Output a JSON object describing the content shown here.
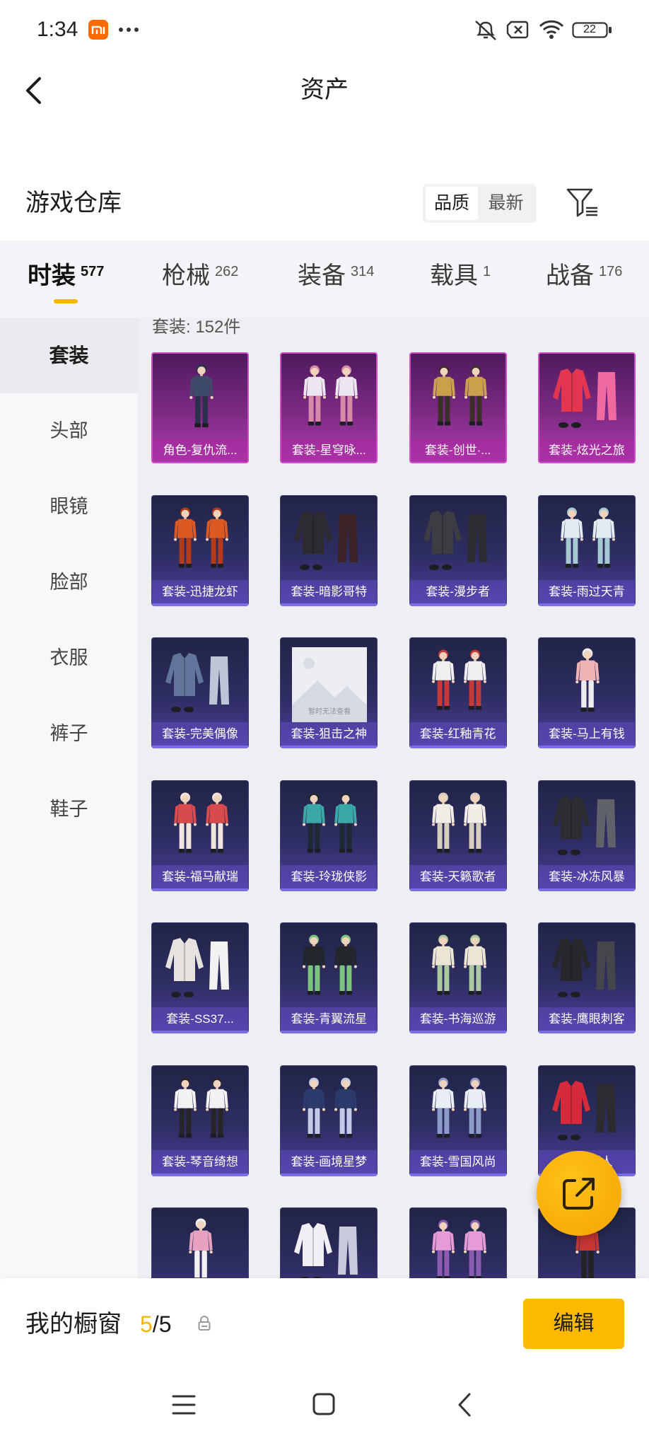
{
  "status_bar": {
    "time": "1:34",
    "battery": "22",
    "icons": [
      "xiaomi-icon",
      "more-dots-icon",
      "mute-icon",
      "no-sim-icon",
      "wifi-icon",
      "battery-icon"
    ]
  },
  "header": {
    "title": "资产",
    "back_icon": "chevron-left-icon"
  },
  "warehouse": {
    "title": "游戏仓库",
    "sort_options": [
      {
        "label": "品质",
        "active": true
      },
      {
        "label": "最新",
        "active": false
      }
    ],
    "filter_icon": "filter-icon"
  },
  "tabs": [
    {
      "label": "时装",
      "count": "577",
      "active": true
    },
    {
      "label": "枪械",
      "count": "262",
      "active": false
    },
    {
      "label": "装备",
      "count": "314",
      "active": false
    },
    {
      "label": "载具",
      "count": "1",
      "active": false
    },
    {
      "label": "战备",
      "count": "176",
      "active": false
    }
  ],
  "sidebar": {
    "items": [
      {
        "label": "套装",
        "active": true
      },
      {
        "label": "头部",
        "active": false
      },
      {
        "label": "眼镜",
        "active": false
      },
      {
        "label": "脸部",
        "active": false
      },
      {
        "label": "衣服",
        "active": false
      },
      {
        "label": "裤子",
        "active": false
      },
      {
        "label": "鞋子",
        "active": false
      }
    ]
  },
  "grid": {
    "count_label": "套装: 152件",
    "items": [
      {
        "label": "角色-复仇流...",
        "rarity": "legendary",
        "art": "figures",
        "figures": 1,
        "palette": [
          "#3d4a68",
          "#29324a"
        ]
      },
      {
        "label": "套装-星穹咏...",
        "rarity": "legendary",
        "art": "figures",
        "figures": 2,
        "palette": [
          "#ece6f0",
          "#d58aa8"
        ]
      },
      {
        "label": "套装-创世·...",
        "rarity": "legendary",
        "art": "figures",
        "figures": 2,
        "palette": [
          "#c9a14c",
          "#3b2f2a"
        ]
      },
      {
        "label": "套装-炫光之旅",
        "rarity": "legendary",
        "art": "garments",
        "palette": [
          "#e23650",
          "#f06aa0"
        ]
      },
      {
        "label": "套装-迅捷龙虾",
        "rarity": "epic",
        "art": "figures",
        "figures": 2,
        "palette": [
          "#dc5a22",
          "#b33b1a"
        ]
      },
      {
        "label": "套装-暗影哥特",
        "rarity": "epic",
        "art": "garments",
        "palette": [
          "#2d2b30",
          "#3a2226"
        ]
      },
      {
        "label": "套装-漫步者",
        "rarity": "epic",
        "art": "garments",
        "palette": [
          "#3c3d43",
          "#2c2d33"
        ]
      },
      {
        "label": "套装-雨过天青",
        "rarity": "epic",
        "art": "figures",
        "figures": 2,
        "palette": [
          "#e3ebf0",
          "#a6c8d2"
        ]
      },
      {
        "label": "套装-完美偶像",
        "rarity": "epic",
        "art": "garments",
        "palette": [
          "#61759a",
          "#bcc6d8"
        ]
      },
      {
        "label": "套装-狙击之神",
        "rarity": "epic",
        "art": "placeholder",
        "placeholder_text": "暂时无法查看"
      },
      {
        "label": "套装-红釉青花",
        "rarity": "epic",
        "art": "figures",
        "figures": 2,
        "palette": [
          "#f0eeee",
          "#c43a3a"
        ]
      },
      {
        "label": "套装-马上有钱",
        "rarity": "epic",
        "art": "figures",
        "figures": 1,
        "palette": [
          "#f0b3b5",
          "#ededed"
        ]
      },
      {
        "label": "套装-福马献瑞",
        "rarity": "epic",
        "art": "figures",
        "figures": 2,
        "palette": [
          "#d94a4d",
          "#f1e4df"
        ]
      },
      {
        "label": "套装-玲珑侠影",
        "rarity": "epic",
        "art": "figures",
        "figures": 2,
        "palette": [
          "#3ba7a7",
          "#1e2a33"
        ]
      },
      {
        "label": "套装-天籁歌者",
        "rarity": "epic",
        "art": "figures",
        "figures": 2,
        "palette": [
          "#f1ede6",
          "#d6cebe"
        ]
      },
      {
        "label": "套装-冰冻风暴",
        "rarity": "epic",
        "art": "garments",
        "palette": [
          "#2b2d31",
          "#5f6268"
        ]
      },
      {
        "label": "套装-SS37...",
        "rarity": "epic",
        "art": "garments",
        "palette": [
          "#e6e3de",
          "#f2f2f2"
        ]
      },
      {
        "label": "套装-青翼流星",
        "rarity": "epic",
        "art": "figures",
        "figures": 2,
        "palette": [
          "#20262a",
          "#7cc47c"
        ]
      },
      {
        "label": "套装-书海巡游",
        "rarity": "epic",
        "art": "figures",
        "figures": 2,
        "palette": [
          "#ebe5d3",
          "#a9c9a1"
        ]
      },
      {
        "label": "套装-鹰眼刺客",
        "rarity": "epic",
        "art": "garments",
        "palette": [
          "#27282c",
          "#44464c"
        ]
      },
      {
        "label": "套装-琴音绮想",
        "rarity": "epic",
        "art": "figures",
        "figures": 2,
        "palette": [
          "#f2f2f2",
          "#26262a"
        ]
      },
      {
        "label": "套装-画境星梦",
        "rarity": "epic",
        "art": "figures",
        "figures": 2,
        "palette": [
          "#2b3b6b",
          "#c2cae8"
        ]
      },
      {
        "label": "套装-雪国风尚",
        "rarity": "epic",
        "art": "figures",
        "figures": 2,
        "palette": [
          "#e9edf5",
          "#8c9bc9"
        ]
      },
      {
        "label": "套装-潮人",
        "rarity": "epic",
        "art": "garments",
        "palette": [
          "#d5293c",
          "#2c2c30"
        ]
      },
      {
        "label": "",
        "rarity": "epic",
        "art": "figures",
        "figures": 1,
        "palette": [
          "#e6a2bf",
          "#f1f1f1"
        ]
      },
      {
        "label": "",
        "rarity": "epic",
        "art": "garments",
        "palette": [
          "#f0f0f4",
          "#c9c9dc"
        ]
      },
      {
        "label": "",
        "rarity": "epic",
        "art": "figures",
        "figures": 2,
        "palette": [
          "#e69ad6",
          "#8b5bb1"
        ]
      },
      {
        "label": "",
        "rarity": "epic",
        "art": "figures",
        "figures": 1,
        "palette": [
          "#c73636",
          "#232326"
        ]
      }
    ]
  },
  "fab": {
    "icon": "external-share-icon"
  },
  "showcase": {
    "label": "我的橱窗",
    "used": "5",
    "separator": "/",
    "total": "5",
    "lock_icon": "lock-icon",
    "edit_label": "编辑"
  },
  "nav_bar": {
    "icons": [
      "menu-icon",
      "home-square-icon",
      "back-nav-icon"
    ]
  },
  "colors": {
    "accent": "#f7b500",
    "legendary": "#d24cc6",
    "epic": "#7b6de6",
    "text": "#222222"
  }
}
